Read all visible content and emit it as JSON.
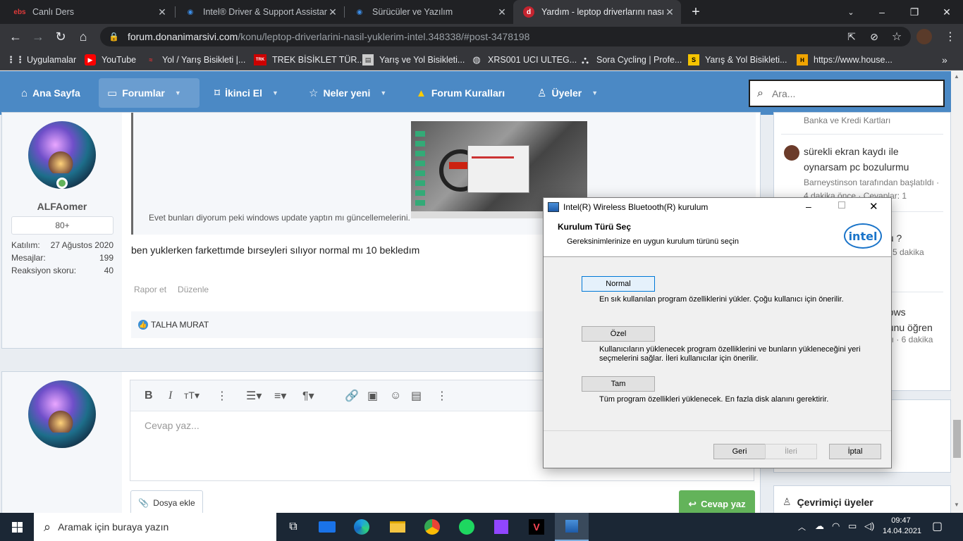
{
  "tabs": [
    {
      "title": "Canlı Ders",
      "favicon": "ebs",
      "active": false
    },
    {
      "title": "Intel® Driver & Support Assistan",
      "favicon": "intel",
      "active": false
    },
    {
      "title": "Sürücüler ve Yazılım",
      "favicon": "intel",
      "active": false
    },
    {
      "title": "Yardım - leptop driverlarını nasıl y",
      "favicon": "donanimarsivi",
      "active": true
    }
  ],
  "address": {
    "domain": "forum.donanimarsivi.com",
    "path": "/konu/leptop-driverlarini-nasil-yuklerim-intel.348338/#post-3478198"
  },
  "bookmarks": [
    "Uygulamalar",
    "YouTube",
    "Yol / Yarış Bisikleti |...",
    "TREK BİSİKLET TÜR...",
    "Yarış ve Yol Bisikleti...",
    "XRS001 UCI ULTEG...",
    "Sora Cycling | Profe...",
    "Yarış & Yol Bisikleti...",
    "https://www.house..."
  ],
  "forumnav": {
    "items": [
      "Ana Sayfa",
      "Forumlar",
      "İkinci El",
      "Neler yeni",
      "Forum Kuralları",
      "Üyeler"
    ],
    "search_placeholder": "Ara..."
  },
  "post": {
    "quote_text": "Evet bunları diyorum peki windows update yaptın mı güncellemelerini.",
    "body": "ben yuklerken farkettımde bırseyleri sılıyor normal mı 10 bekledım",
    "actions": [
      "Rapor et",
      "Düzenle"
    ],
    "liker": "TALHA MURAT"
  },
  "user": {
    "name": "ALFAomer",
    "badge": "80+",
    "stats": [
      {
        "label": "Katılım:",
        "value": "27 Ağustos 2020"
      },
      {
        "label": "Mesajlar:",
        "value": "199"
      },
      {
        "label": "Reaksiyon skoru:",
        "value": "40"
      }
    ]
  },
  "editor": {
    "placeholder": "Cevap yaz...",
    "attach_label": "Dosya ekle",
    "reply_label": "Cevap yaz"
  },
  "sidebar": {
    "item0_sub": "Banka ve Kredi Kartları",
    "item1_title_1": "sürekli ekran kaydı ile",
    "item1_title_2": "oynarsam pc bozulurmu",
    "item1_meta": "Barneystinson tarafından başlatıldı ·",
    "item1_meta2": "4 dakika önce · Cevaplar: 1",
    "item2_title": "nu ?",
    "item2_meta": "ı · 5 dakika",
    "item3_title_1": "dows",
    "item3_title_2": "ğunu öğren",
    "item3_meta": "ıldı · 6 dakika",
    "online_title": "Çevrimiçi üyeler"
  },
  "dialog": {
    "title": "Intel(R) Wireless Bluetooth(R) kurulum",
    "heading": "Kurulum Türü Seç",
    "subheading": "Gereksinimlerinize en uygun kurulum türünü seçin",
    "logo": "intel",
    "options": [
      {
        "label": "Normal",
        "desc": "En sık kullanılan program özelliklerini yükler. Çoğu kullanıcı için önerilir."
      },
      {
        "label": "Özel",
        "desc": "Kullanıcıların yüklenecek program özelliklerini ve bunların yükleneceğini yeri seçmelerini sağlar. İleri kullanıcılar için önerilir."
      },
      {
        "label": "Tam",
        "desc": "Tüm program özellikleri yüklenecek. En fazla disk alanını gerektirir."
      }
    ],
    "back": "Geri",
    "next": "İleri",
    "cancel": "İptal"
  },
  "taskbar": {
    "search_placeholder": "Aramak için buraya yazın",
    "time": "09:47",
    "date": "14.04.2021"
  },
  "colors": {
    "forum_nav": "#4b89c5",
    "reply_button": "#63b35a",
    "taskbar": "#1b2735"
  }
}
